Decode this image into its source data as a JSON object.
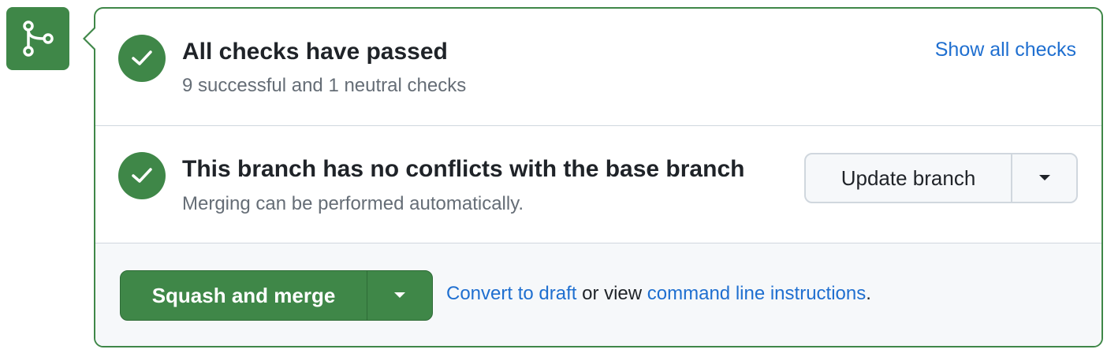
{
  "colors": {
    "success": "#3f8748",
    "link": "#1f6fd0",
    "text_primary": "#1f2328",
    "text_muted": "#656d76",
    "border": "#d0d7de"
  },
  "icons": {
    "merge_box": "git-merge-icon",
    "check": "check-icon",
    "caret": "triangle-down-icon"
  },
  "checks": {
    "title": "All checks have passed",
    "subtitle": "9 successful and 1 neutral checks",
    "show_all_link": "Show all checks"
  },
  "conflicts": {
    "title": "This branch has no conflicts with the base branch",
    "subtitle": "Merging can be performed automatically.",
    "update_button": "Update branch"
  },
  "merge": {
    "button_label": "Squash and merge",
    "convert_link": "Convert to draft",
    "or_view_text": " or view ",
    "cli_link": "command line instructions",
    "period": "."
  }
}
